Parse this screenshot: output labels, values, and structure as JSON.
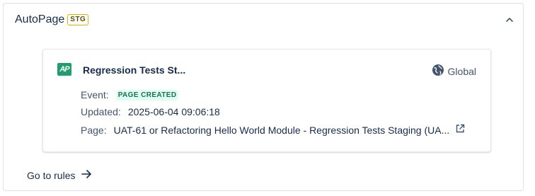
{
  "section": {
    "title": "AutoPage",
    "env_badge": "STG"
  },
  "card": {
    "logo_text": "AP",
    "title": "Regression Tests St...",
    "scope": "Global",
    "event_label": "Event:",
    "event_value": "PAGE CREATED",
    "updated_label": "Updated:",
    "updated_value": "2025-06-04 09:06:18",
    "page_label": "Page:",
    "page_value": "UAT-61 or Refactoring Hello World Module - Regression Tests Staging (UA..."
  },
  "footer": {
    "goto_label": "Go to rules"
  },
  "icons": [
    "chevron-up-icon",
    "globe-icon",
    "external-link-icon",
    "arrow-right-icon"
  ]
}
